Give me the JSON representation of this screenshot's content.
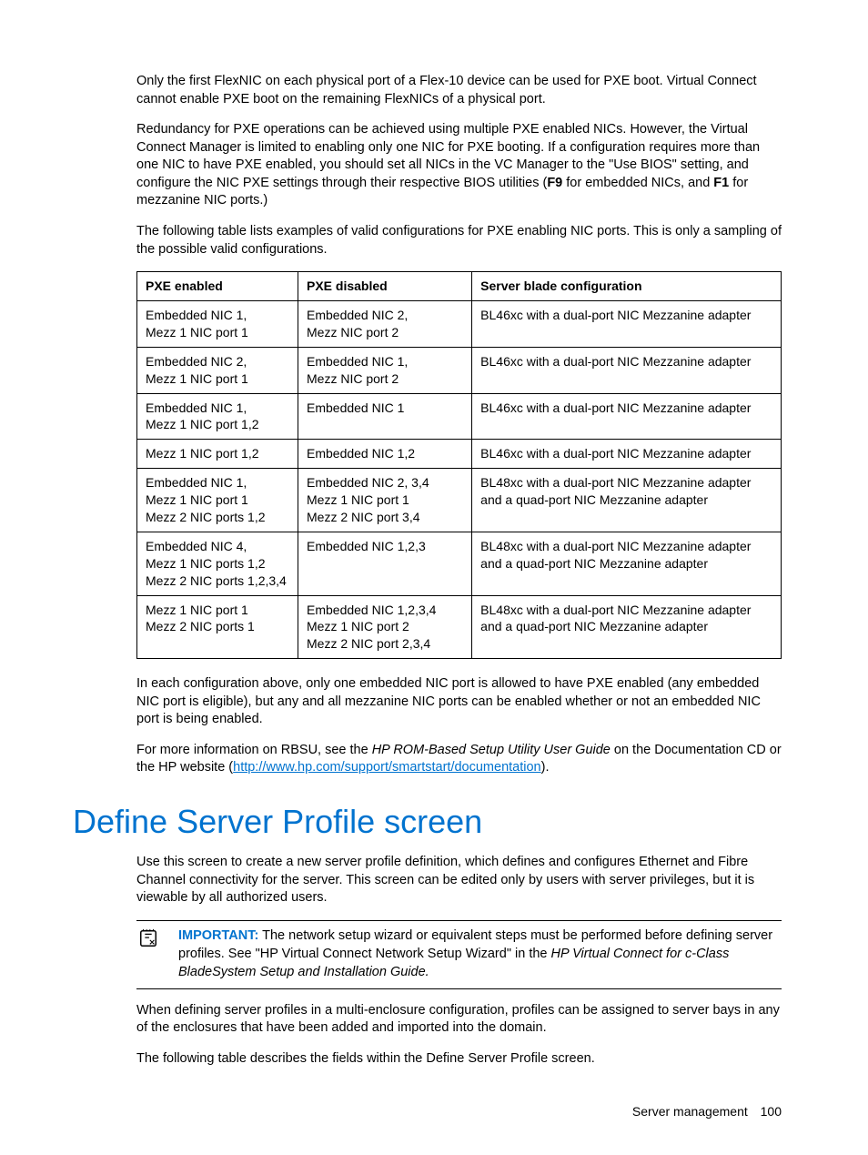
{
  "para1": "Only the first FlexNIC on each physical port of a Flex-10 device can be used for PXE boot. Virtual Connect cannot enable PXE boot on the remaining FlexNICs of a physical port.",
  "para2_a": "Redundancy for PXE operations can be achieved using multiple PXE enabled NICs. However, the Virtual Connect Manager is limited to enabling only one NIC for PXE booting. If a configuration requires more than one NIC to have PXE enabled, you should set all NICs in the VC Manager to the \"Use BIOS\" setting, and configure the NIC PXE settings through their respective BIOS utilities (",
  "para2_f9": "F9",
  "para2_b": " for embedded NICs, and ",
  "para2_f1": "F1",
  "para2_c": " for mezzanine NIC ports.)",
  "para3": "The following table lists examples of valid configurations for PXE enabling NIC ports. This is only a sampling of the possible valid configurations.",
  "table": {
    "headers": [
      "PXE enabled",
      "PXE disabled",
      "Server blade configuration"
    ],
    "rows": [
      [
        "Embedded NIC 1,\nMezz 1 NIC port 1",
        "Embedded NIC 2,\nMezz NIC port 2",
        "BL46xc with a dual-port NIC Mezzanine adapter"
      ],
      [
        "Embedded NIC 2,\nMezz 1 NIC port 1",
        "Embedded NIC 1,\nMezz NIC port 2",
        "BL46xc with a dual-port NIC Mezzanine adapter"
      ],
      [
        "Embedded NIC 1,\nMezz 1 NIC port 1,2",
        "Embedded NIC 1",
        "BL46xc with a dual-port NIC Mezzanine adapter"
      ],
      [
        "Mezz 1 NIC port 1,2",
        "Embedded NIC 1,2",
        "BL46xc with a dual-port NIC Mezzanine adapter"
      ],
      [
        "Embedded NIC 1,\nMezz 1 NIC port 1\nMezz 2 NIC ports 1,2",
        "Embedded NIC 2, 3,4\nMezz 1 NIC port 1\nMezz 2 NIC port 3,4",
        "BL48xc with a dual-port NIC Mezzanine adapter and a quad-port NIC Mezzanine adapter"
      ],
      [
        "Embedded NIC 4,\nMezz 1 NIC ports 1,2\nMezz 2 NIC ports 1,2,3,4",
        "Embedded NIC 1,2,3",
        "BL48xc with a dual-port NIC Mezzanine adapter and a quad-port NIC Mezzanine adapter"
      ],
      [
        "Mezz 1 NIC port 1\nMezz 2 NIC ports 1",
        "Embedded NIC 1,2,3,4\nMezz 1 NIC port 2\nMezz 2 NIC port 2,3,4",
        "BL48xc with a dual-port NIC Mezzanine adapter and a quad-port NIC Mezzanine adapter"
      ]
    ]
  },
  "para4": "In each configuration above, only one embedded NIC port is allowed to have PXE enabled (any embedded NIC port is eligible), but any and all mezzanine NIC ports can be enabled whether or not an embedded NIC port is being enabled.",
  "para5_a": "For more information on RBSU, see the ",
  "para5_italic": "HP ROM-Based Setup Utility User Guide",
  "para5_b": " on the Documentation CD or the HP website (",
  "para5_link": "http://www.hp.com/support/smartstart/documentation",
  "para5_c": ").",
  "heading": "Define Server Profile screen",
  "para6": "Use this screen to create a new server profile definition, which defines and configures Ethernet and Fibre Channel connectivity for the server. This screen can be edited only by users with server privileges, but it is viewable by all authorized users.",
  "important_label": "IMPORTANT:",
  "important_text_a": "  The network setup wizard or equivalent steps must be performed before defining server profiles. See \"HP Virtual Connect Network Setup Wizard\" in the ",
  "important_italic": "HP Virtual Connect for c-Class BladeSystem Setup and Installation Guide.",
  "para7": "When defining server profiles in a multi-enclosure configuration, profiles can be assigned to server bays in any of the enclosures that have been added and imported into the domain.",
  "para8": "The following table describes the fields within the Define Server Profile screen.",
  "footer_section": "Server management",
  "footer_page": "100"
}
